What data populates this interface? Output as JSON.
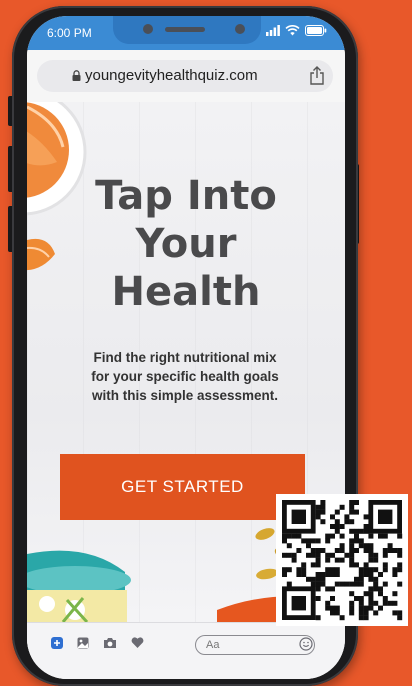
{
  "status": {
    "time": "6:00 PM"
  },
  "browser": {
    "url": "youngevityhealthquiz.com"
  },
  "hero": {
    "headline_line1": "Tap Into",
    "headline_line2": "Your",
    "headline_line3": "Health",
    "subtext_line1": "Find the right nutritional mix",
    "subtext_line2": "for your specific health goals",
    "subtext_line3": "with this simple assessment."
  },
  "cta": {
    "label": "GET STARTED"
  },
  "message_bar": {
    "placeholder": "Aa"
  },
  "colors": {
    "background": "#e8582a",
    "cta": "#e0531f",
    "status_bar": "#3b8bd4"
  },
  "icons": [
    "lock-icon",
    "share-icon",
    "signal-icon",
    "wifi-icon",
    "battery-icon",
    "plus-icon",
    "gallery-icon",
    "camera-icon",
    "heart-icon",
    "emoji-icon",
    "qr-code"
  ]
}
